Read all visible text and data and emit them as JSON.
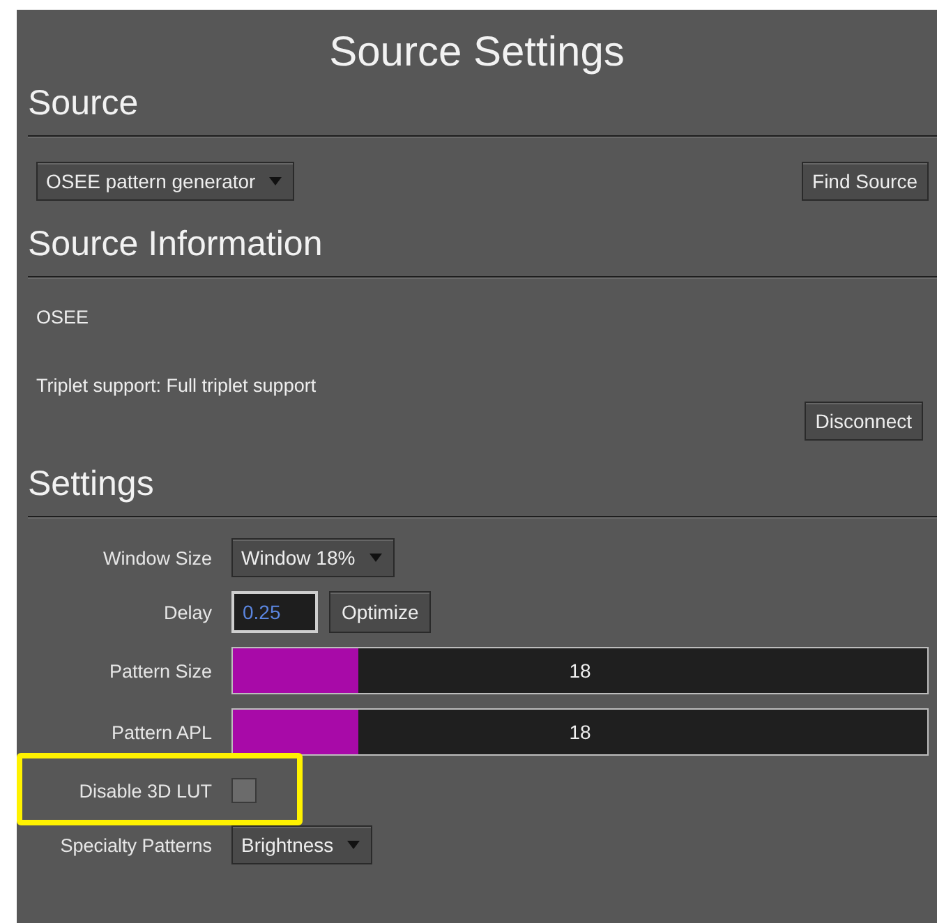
{
  "title": "Source Settings",
  "source": {
    "heading": "Source",
    "dropdown": "OSEE pattern generator",
    "button": "Find Source"
  },
  "source_information": {
    "heading": "Source Information",
    "lines": [
      "OSEE",
      "Triplet support: Full triplet support"
    ],
    "button": "Disconnect"
  },
  "settings": {
    "heading": "Settings",
    "rows": [
      {
        "kind": "dropdown",
        "label": "Window Size",
        "value": "Window 18%"
      },
      {
        "kind": "input",
        "label": "Delay",
        "value": "0.25",
        "button": "Optimize"
      },
      {
        "kind": "slider",
        "label": "Pattern Size",
        "level": 0.18,
        "reading": "18"
      },
      {
        "kind": "slider",
        "label": "Pattern APL",
        "level": 0.18,
        "reading": "18"
      },
      {
        "kind": "checkbox",
        "label": "Disable 3D LUT",
        "checked": false,
        "highlighted": true
      },
      {
        "kind": "dropdown",
        "label": "Specialty Patterns",
        "value": "Brightness"
      }
    ]
  }
}
